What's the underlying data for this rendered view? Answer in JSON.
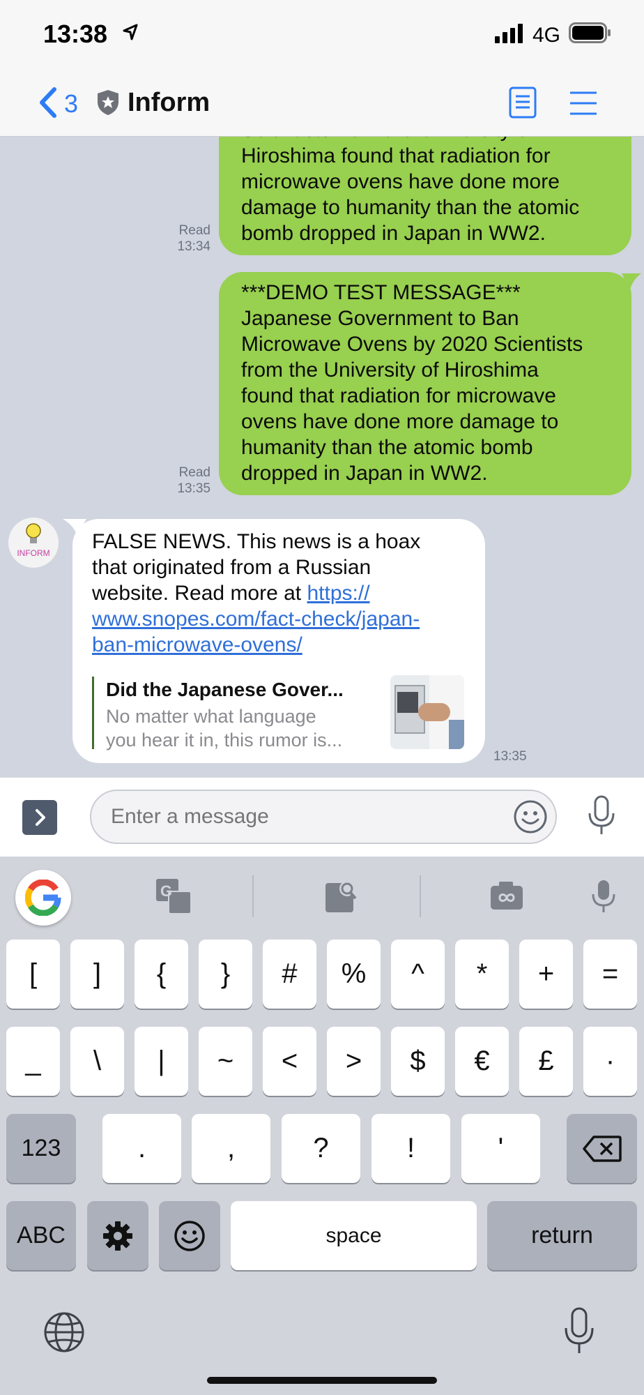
{
  "status": {
    "time": "13:38",
    "network": "4G"
  },
  "header": {
    "back_count": "3",
    "title": "Inform"
  },
  "chat": {
    "msg1": {
      "lines": [
        "Scientists from the University of",
        "Hiroshima found that radiation for",
        "microwave ovens have done more",
        "damage to humanity than the atomic",
        "bomb dropped in Japan in WW2."
      ],
      "status": "Read",
      "time": "13:34"
    },
    "msg2": {
      "lines": [
        "***DEMO TEST MESSAGE***",
        "Japanese Government to Ban",
        "Microwave Ovens by 2020 Scientists",
        "from the University of Hiroshima",
        "found that radiation for microwave",
        "ovens have done more damage to",
        "humanity than the atomic bomb",
        "dropped in Japan in WW2."
      ],
      "status": "Read",
      "time": "13:35"
    },
    "reply": {
      "avatar_label": "INFORM",
      "line1": "FALSE NEWS. This news is a hoax",
      "line2": "that originated from a Russian",
      "line3_text": "website. Read more at ",
      "link_part1": "https://",
      "link_part2": "www.snopes.com/fact-check/japan-",
      "link_part3": "ban-microwave-ovens/",
      "preview_title": "Did the Japanese Gover...",
      "preview_line1": "No matter what language",
      "preview_line2": "you hear it in, this rumor is...",
      "time": "13:35"
    }
  },
  "input": {
    "placeholder": "Enter a message"
  },
  "keyboard": {
    "row1": [
      "[",
      "]",
      "{",
      "}",
      "#",
      "%",
      "^",
      "*",
      "+",
      "="
    ],
    "row2": [
      "_",
      "\\",
      "|",
      "~",
      "<",
      ">",
      "$",
      "€",
      "£",
      "·"
    ],
    "row3_left": "123",
    "row3": [
      ".",
      ",",
      "?",
      "!",
      "'"
    ],
    "abc": "ABC",
    "space": "space",
    "return": "return"
  },
  "colors": {
    "accent": "#2d7cf6",
    "outgoing_bubble": "#98d04f",
    "link": "#2f6fd8"
  }
}
